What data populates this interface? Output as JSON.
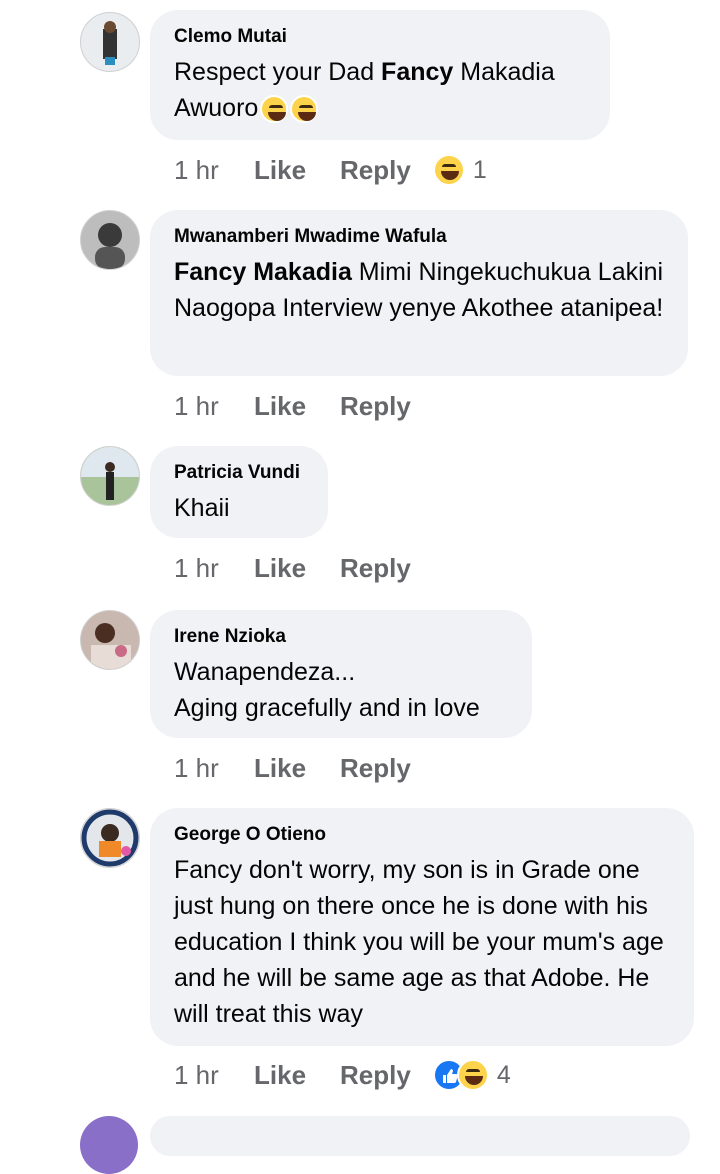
{
  "comments": [
    {
      "name": "Clemo Mutai",
      "text_pre": "Respect your Dad  ",
      "text_bold": "Fancy",
      "text_post": " Makadia Awuoro",
      "time": "1 hr",
      "like": "Like",
      "reply": "Reply",
      "reaction_icons": [
        "laugh-emoji"
      ],
      "reaction_count": "1",
      "inline_emojis": [
        "laugh-with-tears-emoji",
        "laugh-with-tears-emoji"
      ]
    },
    {
      "name": "Mwanamberi Mwadime Wafula",
      "text_bold": "Fancy Makadia",
      "text_post": " Mimi Ningekuchukua Lakini Naogopa Interview yenye Akothee atanipea!",
      "time": "1 hr",
      "like": "Like",
      "reply": "Reply"
    },
    {
      "name": "Patricia Vundi",
      "text": "Khaii",
      "time": "1 hr",
      "like": "Like",
      "reply": "Reply"
    },
    {
      "name": "Irene Nzioka",
      "text_line1": "Wanapendeza...",
      "text_line2": "Aging gracefully and in love",
      "time": "1 hr",
      "like": "Like",
      "reply": "Reply"
    },
    {
      "name": "George O Otieno",
      "text": "Fancy  don't worry, my son is in Grade one just hung on there once he is done with his education I think you will be your mum's age and he will be same age as that Adobe. He will treat this way",
      "time": "1 hr",
      "like": "Like",
      "reply": "Reply",
      "reaction_icons": [
        "like-icon",
        "laugh-emoji"
      ],
      "reaction_count": "4"
    }
  ],
  "colors": {
    "bubble": "#f0f2f5",
    "meta": "#65676b",
    "like_blue": "#1877f2",
    "laugh_yellow": "#fcd34a"
  }
}
